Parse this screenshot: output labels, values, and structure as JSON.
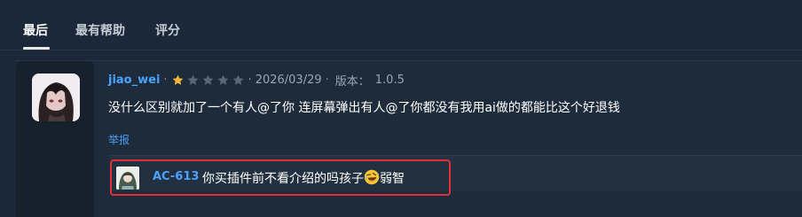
{
  "tabs": [
    {
      "label": "最后",
      "active": true
    },
    {
      "label": "最有帮助",
      "active": false
    },
    {
      "label": "评分",
      "active": false
    }
  ],
  "review": {
    "username": "jiao_wei",
    "rating": 1,
    "rating_max": 5,
    "date": "2026/03/29",
    "version_label": "版本：",
    "version": "1.0.5",
    "text": "没什么区别就加了一个有人@了你 连屏幕弹出有人@了你都没有我用ai做的都能比这个好退钱",
    "report_label": "举报"
  },
  "reply": {
    "username": "AC-613",
    "text_before": "你买插件前不看介绍的吗孩子",
    "emoji": "rolling-on-floor-laughing-emoji",
    "text_after": "弱智"
  },
  "colors": {
    "background": "#1b2839",
    "link": "#4aa3ff",
    "star_filled": "#f4b73b",
    "star_empty": "#5a6776",
    "highlight": "#e02f36"
  }
}
